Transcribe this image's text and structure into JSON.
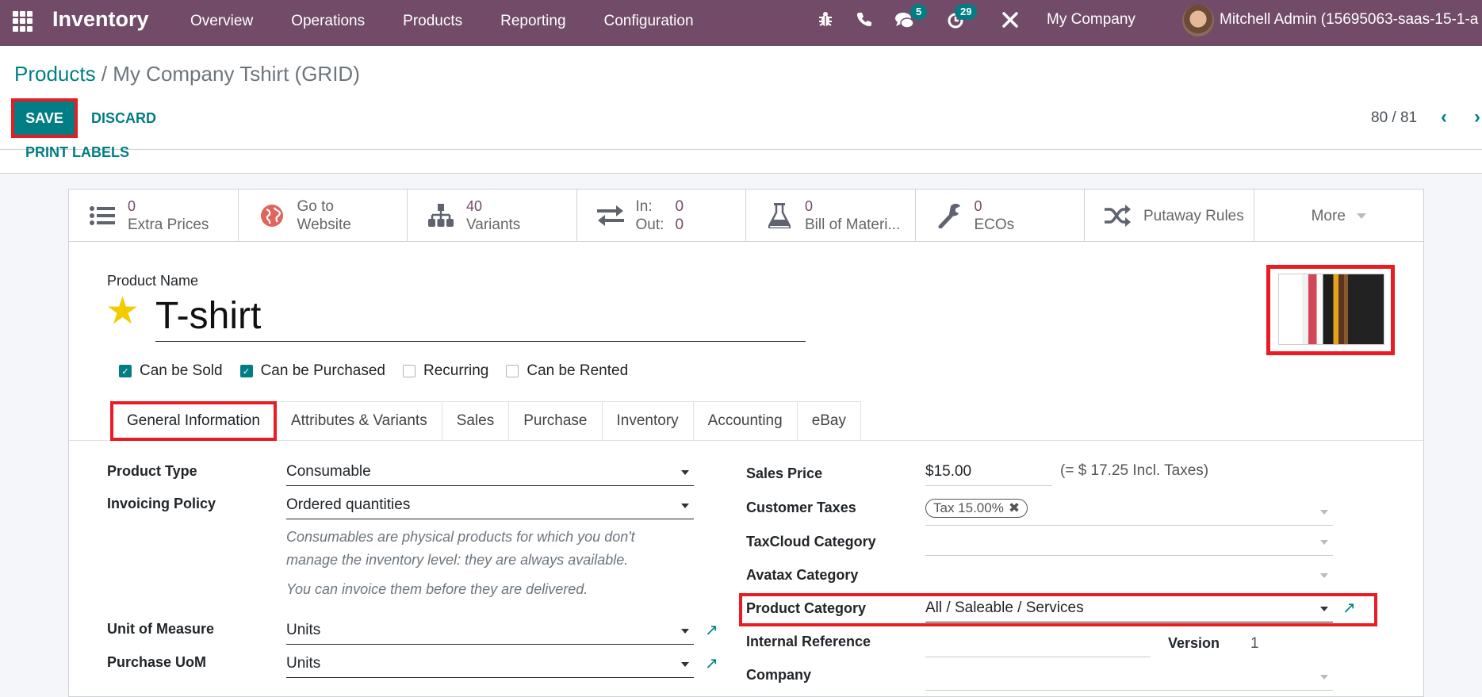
{
  "navbar": {
    "app_name": "Inventory",
    "menu": [
      "Overview",
      "Operations",
      "Products",
      "Reporting",
      "Configuration"
    ],
    "icons": [
      "bug-icon",
      "phone-icon",
      "chat-icon",
      "activity-clock-icon",
      "tools-icon"
    ],
    "messages_badge": "5",
    "activities_badge": "29",
    "company": "My Company",
    "user": "Mitchell Admin (15695063-saas-15-1-a"
  },
  "breadcrumb": {
    "parent": "Products",
    "separator": " / ",
    "current": "My Company Tshirt (GRID)"
  },
  "control": {
    "save_label": "SAVE",
    "discard_label": "DISCARD",
    "pager": "80 / 81",
    "print_labels": "PRINT LABELS"
  },
  "stat_buttons": [
    {
      "icon": "list-icon",
      "value": "0",
      "label": "Extra Prices"
    },
    {
      "icon": "globe-icon",
      "value": "Go to",
      "label": "Website"
    },
    {
      "icon": "sitemap-icon",
      "value": "40",
      "label": "Variants"
    },
    {
      "icon": "exchange-icon",
      "in_label": "In:",
      "in_value": "0",
      "out_label": "Out:",
      "out_value": "0"
    },
    {
      "icon": "flask-icon",
      "value": "0",
      "label": "Bill of Materi..."
    },
    {
      "icon": "wrench-icon",
      "value": "0",
      "label": "ECOs"
    },
    {
      "icon": "random-icon",
      "label": "Putaway Rules"
    },
    {
      "label": "More"
    }
  ],
  "product": {
    "name_label": "Product Name",
    "name": "T-shirt",
    "favorite": true,
    "checkboxes": [
      {
        "label": "Can be Sold",
        "checked": true
      },
      {
        "label": "Can be Purchased",
        "checked": true
      },
      {
        "label": "Recurring",
        "checked": false
      },
      {
        "label": "Can be Rented",
        "checked": false
      }
    ]
  },
  "tabs": [
    {
      "label": "General Information",
      "active": true
    },
    {
      "label": "Attributes & Variants"
    },
    {
      "label": "Sales"
    },
    {
      "label": "Purchase"
    },
    {
      "label": "Inventory"
    },
    {
      "label": "Accounting"
    },
    {
      "label": "eBay"
    }
  ],
  "left_fields": {
    "product_type": {
      "label": "Product Type",
      "value": "Consumable"
    },
    "invoicing_policy": {
      "label": "Invoicing Policy",
      "value": "Ordered quantities"
    },
    "help_1": "Consumables are physical products for which you don't manage the inventory level: they are always available.",
    "help_2": "You can invoice them before they are delivered.",
    "uom": {
      "label": "Unit of Measure",
      "value": "Units"
    },
    "purchase_uom": {
      "label": "Purchase UoM",
      "value": "Units"
    }
  },
  "right_fields": {
    "sales_price": {
      "label": "Sales Price",
      "value": "$15.00",
      "incl": "(= $ 17.25 Incl. Taxes)"
    },
    "customer_taxes": {
      "label": "Customer Taxes",
      "tag": "Tax 15.00%"
    },
    "taxcloud": {
      "label": "TaxCloud Category",
      "value": ""
    },
    "avatax": {
      "label": "Avatax Category",
      "value": ""
    },
    "category": {
      "label": "Product Category",
      "value": "All / Saleable / Services"
    },
    "internal_ref": {
      "label": "Internal Reference",
      "value": ""
    },
    "version": {
      "label": "Version",
      "value": "1"
    },
    "company": {
      "label": "Company",
      "value": ""
    }
  },
  "colors": {
    "brand": "#714b67",
    "accent": "#017e84",
    "highlight": "#e91c24",
    "star": "#f3cc00"
  }
}
